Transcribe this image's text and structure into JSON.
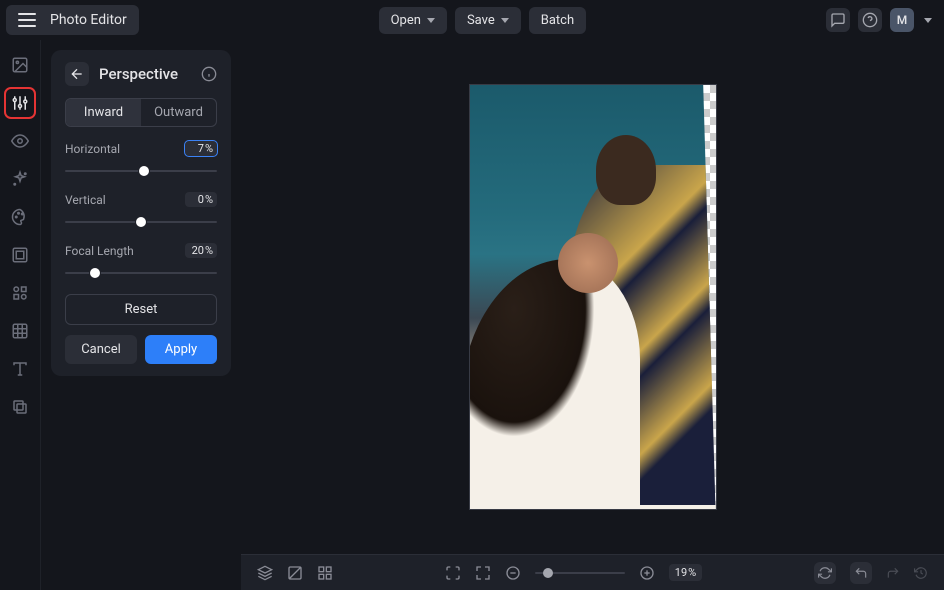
{
  "app": {
    "title": "Photo Editor"
  },
  "topbar": {
    "open": "Open",
    "save": "Save",
    "batch": "Batch",
    "avatar": "M"
  },
  "panel": {
    "title": "Perspective",
    "tabs": {
      "inward": "Inward",
      "outward": "Outward",
      "active": "inward"
    },
    "controls": {
      "horizontal": {
        "label": "Horizontal",
        "value": "7",
        "unit": "%"
      },
      "vertical": {
        "label": "Vertical",
        "value": "0",
        "unit": "%"
      },
      "focal": {
        "label": "Focal Length",
        "value": "20",
        "unit": "%"
      }
    },
    "buttons": {
      "reset": "Reset",
      "cancel": "Cancel",
      "apply": "Apply"
    }
  },
  "bottombar": {
    "zoom_value": "19",
    "zoom_unit": "%"
  }
}
